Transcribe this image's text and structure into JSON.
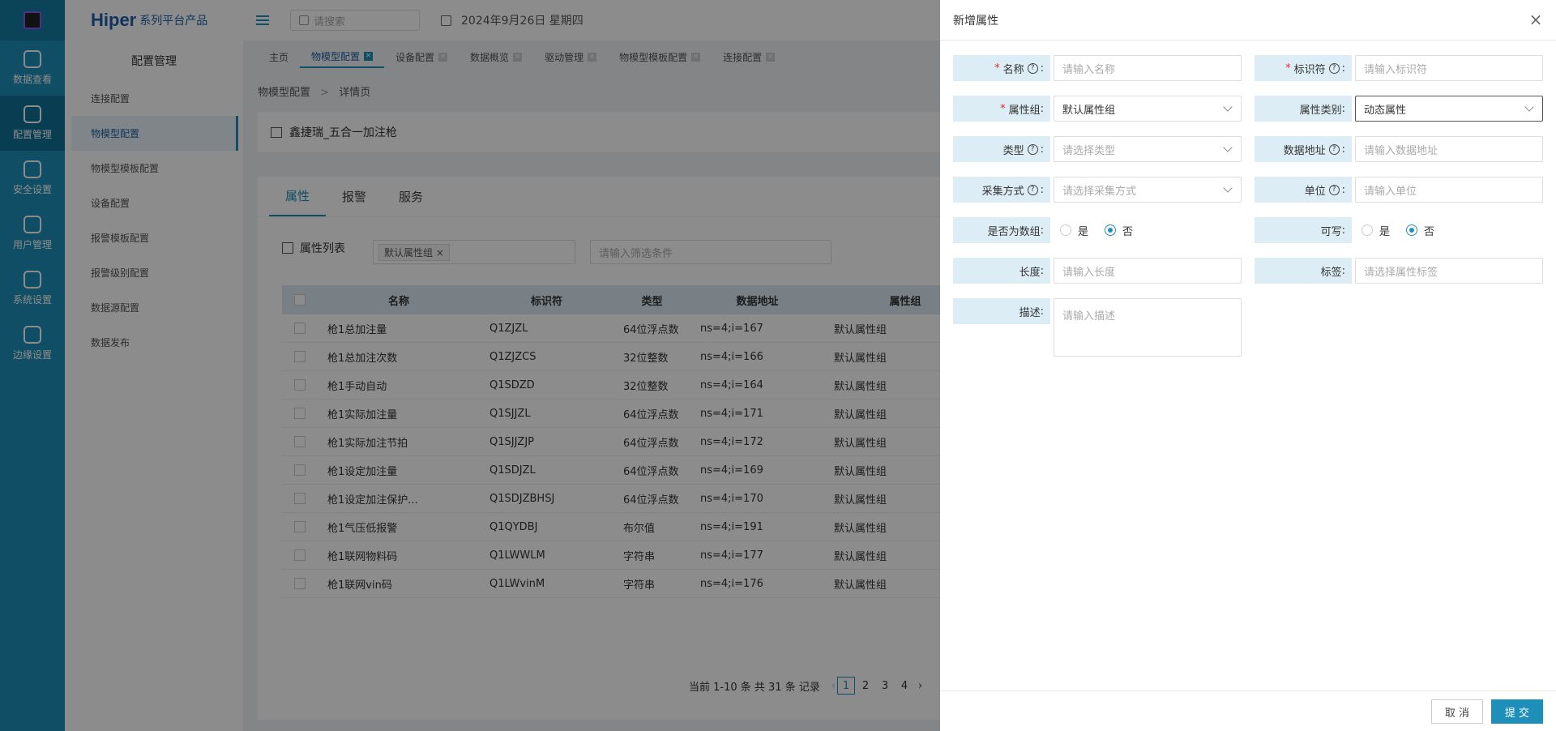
{
  "brand": {
    "name": "Hiper",
    "suffix": "系列平台产品"
  },
  "rail": [
    "数据查看",
    "配置管理",
    "安全设置",
    "用户管理",
    "系统设置",
    "边缘设置"
  ],
  "header": {
    "search_placeholder": "请搜索",
    "date": "2024年9月26日 星期四"
  },
  "sidebar": {
    "title": "配置管理",
    "items": [
      "连接配置",
      "物模型配置",
      "物模型模板配置",
      "设备配置",
      "报警模板配置",
      "报警级别配置",
      "数据源配置",
      "数据发布"
    ]
  },
  "tabs": [
    "主页",
    "物模型配置",
    "设备配置",
    "数据概览",
    "驱动管理",
    "物模型模板配置",
    "连接配置"
  ],
  "breadcrumb": {
    "parent": "物模型配置",
    "sep": ">",
    "current": "详情页"
  },
  "model_title": "鑫捷瑞_五合一加注枪",
  "panel_tabs": [
    "属性",
    "报警",
    "服务"
  ],
  "list": {
    "title": "属性列表",
    "chip": "默认属性组",
    "filter_placeholder": "请输入筛选条件",
    "columns": [
      "名称",
      "标识符",
      "类型",
      "数据地址",
      "属性组"
    ],
    "rows": [
      [
        "枪1总加注量",
        "Q1ZJZL",
        "64位浮点数",
        "ns=4;i=167",
        "默认属性组"
      ],
      [
        "枪1总加注次数",
        "Q1ZJZCS",
        "32位整数",
        "ns=4;i=166",
        "默认属性组"
      ],
      [
        "枪1手动自动",
        "Q1SDZD",
        "32位整数",
        "ns=4;i=164",
        "默认属性组"
      ],
      [
        "枪1实际加注量",
        "Q1SJJZL",
        "64位浮点数",
        "ns=4;i=171",
        "默认属性组"
      ],
      [
        "枪1实际加注节拍",
        "Q1SJJZJP",
        "64位浮点数",
        "ns=4;i=172",
        "默认属性组"
      ],
      [
        "枪1设定加注量",
        "Q1SDJZL",
        "64位浮点数",
        "ns=4;i=169",
        "默认属性组"
      ],
      [
        "枪1设定加注保护...",
        "Q1SDJZBHSJ",
        "64位浮点数",
        "ns=4;i=170",
        "默认属性组"
      ],
      [
        "枪1气压低报警",
        "Q1QYDBJ",
        "布尔值",
        "ns=4;i=191",
        "默认属性组"
      ],
      [
        "枪1联网物料码",
        "Q1LWWLM",
        "字符串",
        "ns=4;i=177",
        "默认属性组"
      ],
      [
        "枪1联网vin码",
        "Q1LWvinM",
        "字符串",
        "ns=4;i=176",
        "默认属性组"
      ]
    ],
    "pager": {
      "summary": "当前 1-10 条 共 31 条 记录",
      "pages": [
        "1",
        "2",
        "3",
        "4"
      ]
    }
  },
  "drawer": {
    "title": "新增属性",
    "name": {
      "label": "名称",
      "placeholder": "请输入名称"
    },
    "identifier": {
      "label": "标识符",
      "placeholder": "请输入标识符"
    },
    "group": {
      "label": "属性组",
      "value": "默认属性组"
    },
    "category": {
      "label": "属性类别",
      "value": "动态属性"
    },
    "type": {
      "label": "类型",
      "placeholder": "请选择类型"
    },
    "address": {
      "label": "数据地址",
      "placeholder": "请输入数据地址"
    },
    "collect": {
      "label": "采集方式",
      "placeholder": "请选择采集方式"
    },
    "unit": {
      "label": "单位",
      "placeholder": "请输入单位"
    },
    "is_array": {
      "label": "是否为数组",
      "yes": "是",
      "no": "否",
      "selected": "否"
    },
    "writable": {
      "label": "可写",
      "yes": "是",
      "no": "否",
      "selected": "否"
    },
    "length": {
      "label": "长度",
      "placeholder": "请输入长度"
    },
    "tag": {
      "label": "标签",
      "placeholder": "请选择属性标签"
    },
    "desc": {
      "label": "描述",
      "placeholder": "请输入描述"
    },
    "cancel": "取 消",
    "submit": "提 交"
  }
}
